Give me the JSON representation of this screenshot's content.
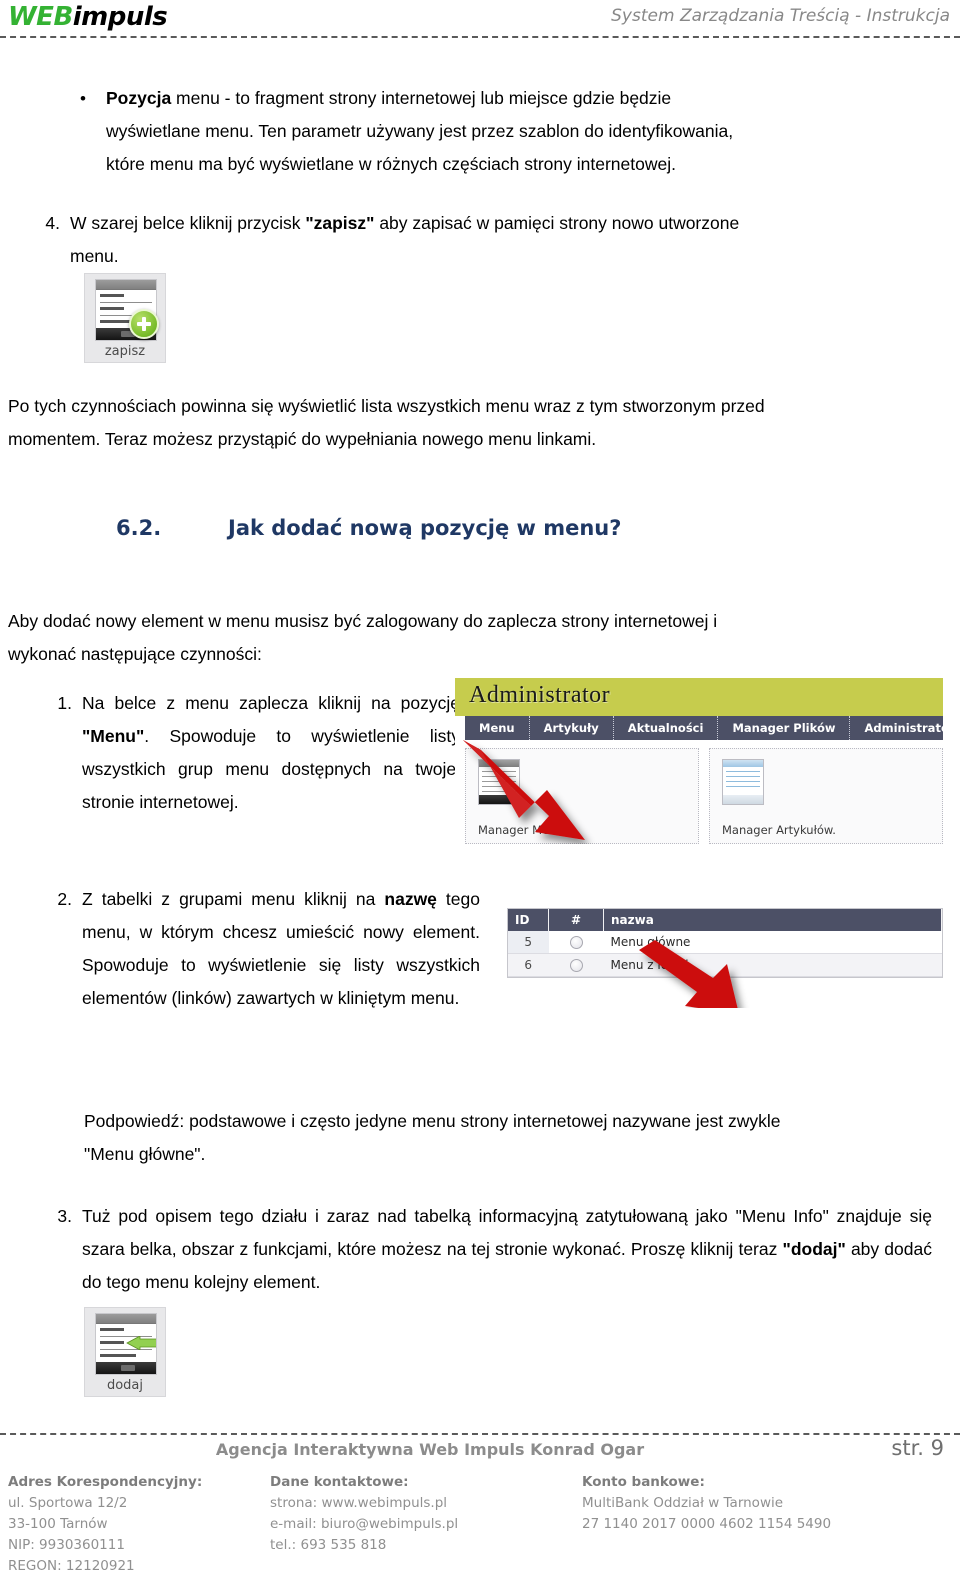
{
  "header": {
    "logo_web": "WEB",
    "logo_impuls": "impuls",
    "title": "System Zarządzania Treścią - Instrukcja"
  },
  "bullet": {
    "bold_lead": "Pozycja",
    "line1_rest": " menu - to fragment strony internetowej lub miejsce gdzie będzie",
    "line2": "wyświetlane menu. Ten parametr używany jest przez szablon do identyfikowania,",
    "line3": "które menu ma być wyświetlane w różnych częściach strony internetowej."
  },
  "item4": {
    "marker": "4.",
    "text_a": "W szarej belce kliknij przycisk ",
    "bold": "\"zapisz\"",
    "text_b": " aby zapisać w pamięci strony nowo utworzone",
    "text_last": "menu."
  },
  "thumb_zapisz": {
    "caption": "zapisz"
  },
  "para_after_zapisz": {
    "line1": "Po tych czynnościach powinna się wyświetlić lista wszystkich menu wraz z tym stworzonym przed",
    "line2": "momentem. Teraz możesz przystąpić do wypełniania nowego menu linkami."
  },
  "heading62": {
    "number": "6.2.",
    "text": "Jak dodać nową pozycję w menu?",
    "color": "#1f3864"
  },
  "para_aby": {
    "line1": "Aby dodać nowy element w  menu musisz być zalogowany do zaplecza strony internetowej i",
    "line2": "wykonać następujące czynności:"
  },
  "item1": {
    "marker": "1.",
    "text_a": "Na belce z menu zaplecza kliknij na pozycję ",
    "bold": "\"Menu\"",
    "text_b": ". Spowoduje to wyświetlenie listy wszystkich grup menu dostępnych na twojej stronie internetowej."
  },
  "item2": {
    "marker": "2.",
    "text_a": "Z tabelki z grupami menu kliknij na ",
    "bold": "nazwę",
    "text_b": " tego menu, w którym chcesz umieścić nowy element. Spowoduje to wyświetlenie się listy wszystkich elementów (linków) zawartych w kliniętym menu."
  },
  "admin_shot": {
    "title": "Administrator",
    "nav_items": [
      "Menu",
      "Artykuły",
      "Aktualności",
      "Manager Plików",
      "Administratorzy"
    ],
    "tiles": [
      {
        "caption": "Manager Menu."
      },
      {
        "caption": "Manager Artykułów."
      }
    ],
    "band_color": "#c6cc4d",
    "nav_color": "#4c5066",
    "arrow_color": "#cc1111",
    "arrow_target": "Menu"
  },
  "table_shot": {
    "columns": [
      "ID",
      "#",
      "nazwa"
    ],
    "rows": [
      {
        "id": "5",
        "name": "Menu główne"
      },
      {
        "id": "6",
        "name": "Menu z lewej"
      }
    ],
    "header_color": "#4c5066",
    "arrow_color": "#cc1111",
    "arrow_target": "Menu główne"
  },
  "para_tip": {
    "line1": "Podpowiedź: podstawowe i często jedyne menu strony internetowej nazywane jest zwykle",
    "line2": "\"Menu główne\"."
  },
  "item3": {
    "marker": "3.",
    "text_a": "Tuż pod opisem tego działu i zaraz nad tabelką informacyjną zatytułowaną jako \"Menu Info\" znajduje się szara belka, obszar z funkcjami, które możesz na tej stronie wykonać. Proszę kliknij teraz ",
    "bold": "\"dodaj\"",
    "text_b": " aby dodać do tego menu kolejny element."
  },
  "thumb_dodaj": {
    "caption": "dodaj"
  },
  "footer": {
    "company": "Agencja Interaktywna Web Impuls Konrad Ogar",
    "page_label": "str. 9",
    "col1": {
      "title": "Adres Korespondencyjny:",
      "lines": [
        "ul. Sportowa 12/2",
        "33-100 Tarnów",
        "NIP: 9930360111",
        "REGON: 12120921"
      ]
    },
    "col2": {
      "title": "Dane kontaktowe:",
      "lines": [
        "strona: www.webimpuls.pl",
        "e-mail: biuro@webimpuls.pl",
        "tel.: 693 535 818"
      ]
    },
    "col3": {
      "title": "Konto bankowe:",
      "lines": [
        "MultiBank Oddział w Tarnowie",
        "27 1140 2017 0000 4602 1154 5490"
      ]
    }
  }
}
